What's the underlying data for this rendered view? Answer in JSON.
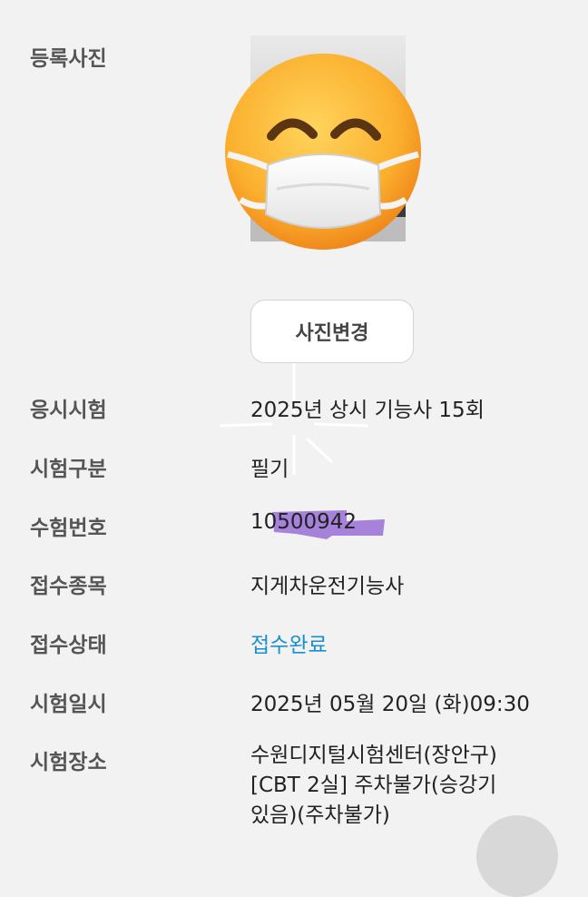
{
  "photo": {
    "label": "등록사진",
    "emoji_icon": "face-with-medical-mask-icon",
    "change_button": "사진변경"
  },
  "rows": [
    {
      "label": "응시시험",
      "value": "2025년 상시 기능사 15회"
    },
    {
      "label": "시험구분",
      "value": "필기"
    },
    {
      "label": "수험번호",
      "value": "10500942"
    },
    {
      "label": "접수종목",
      "value": "지게차운전기능사"
    },
    {
      "label": "접수상태",
      "value": "접수완료"
    },
    {
      "label": "시험일시",
      "value": "2025년 05월 20일 (화)09:30"
    }
  ],
  "location": {
    "label": "시험장소",
    "lines": [
      "수원디지털시험센터(장안구)",
      "[CBT 2실] 주차불가(승강기",
      "있음)(주차불가)"
    ]
  },
  "colors": {
    "status_blue": "#1a8fd0",
    "redaction_purple": "#9a6fd6"
  }
}
